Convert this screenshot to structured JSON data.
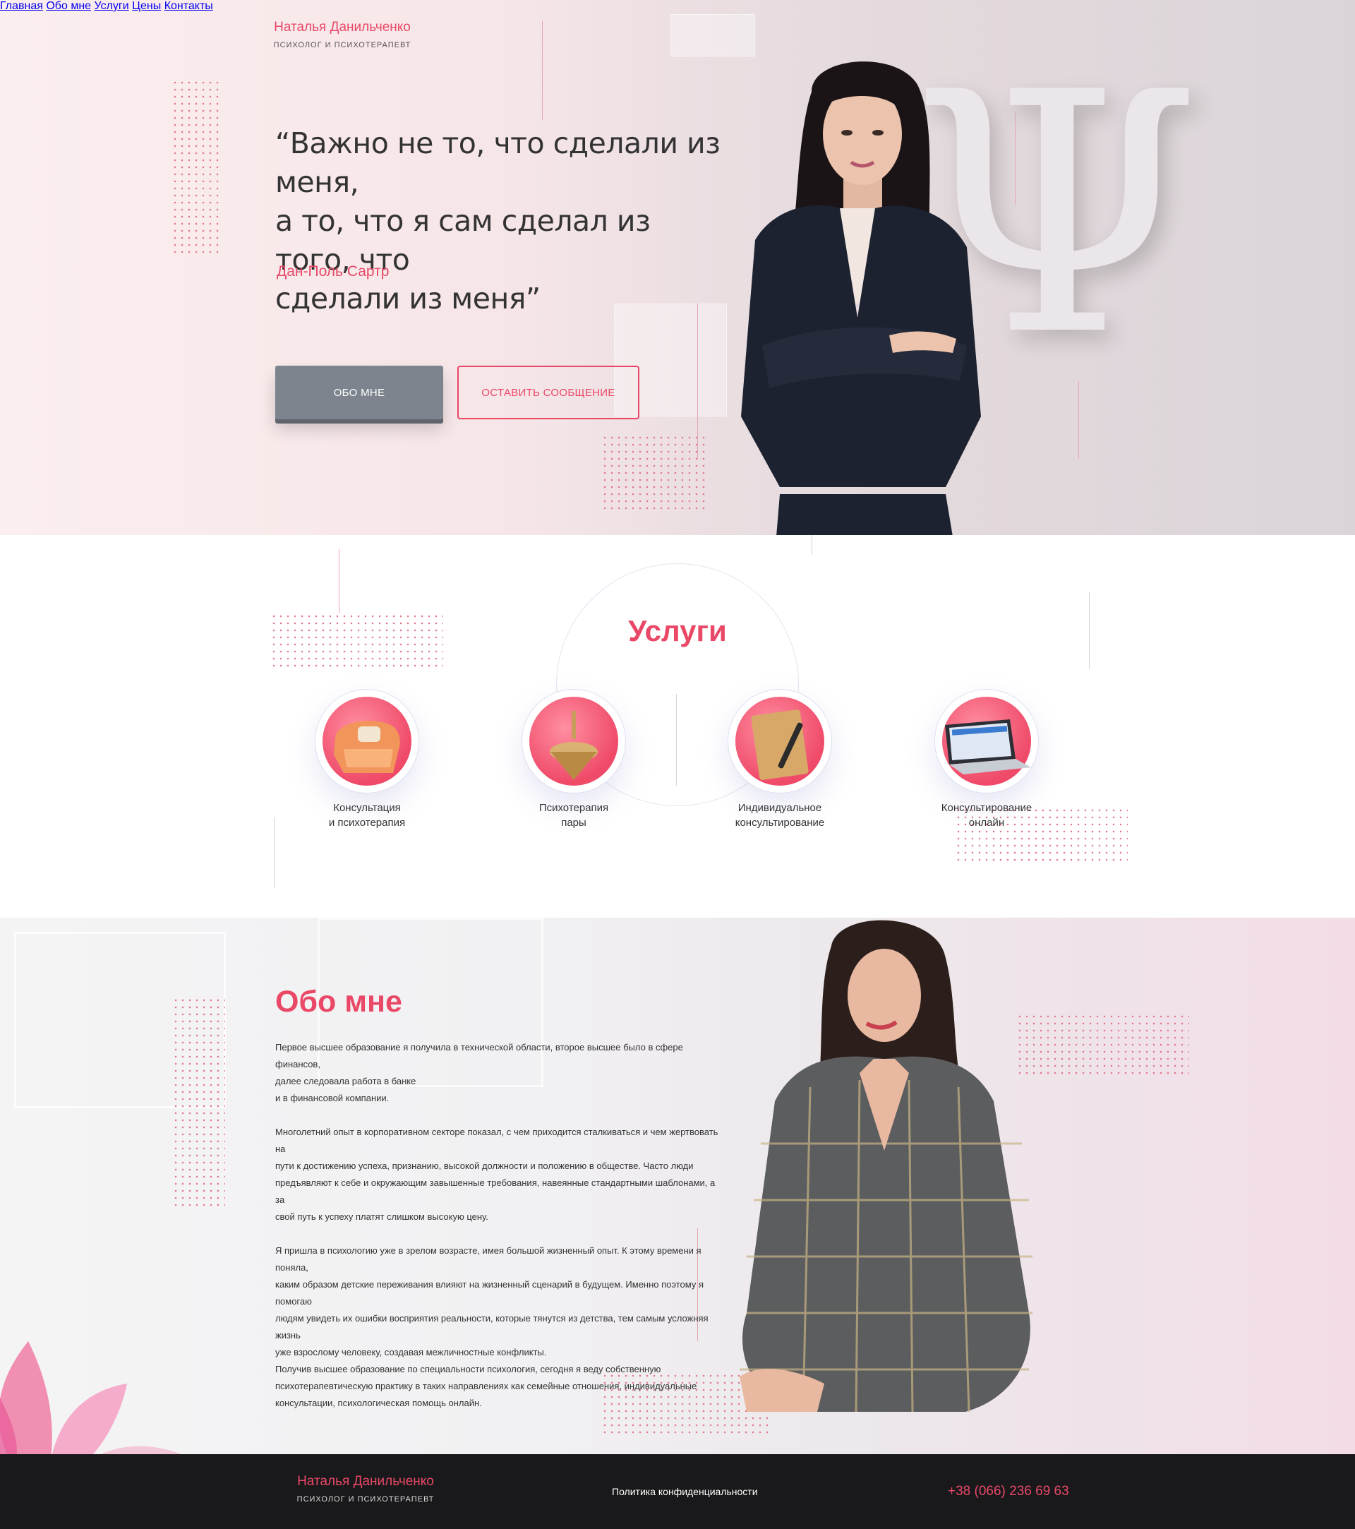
{
  "brand": {
    "name": "Наталья Данильченко",
    "subtitle": "ПСИХОЛОГ И ПСИХОТЕРАПЕВТ"
  },
  "nav": {
    "items": [
      {
        "label": "Главная"
      },
      {
        "label": "Обо мне"
      },
      {
        "label": "Услуги"
      },
      {
        "label": "Цены"
      },
      {
        "label": "Контакты"
      }
    ]
  },
  "hero": {
    "quote_lines": [
      "“Важно не то, что сделали из меня,",
      "а то, что я сам сделал из того, что",
      "сделали из меня”"
    ],
    "author": "Дан-Поль Сартр",
    "primary_button": "ОБО МНЕ",
    "secondary_button": "ОСТАВИТЬ СООБЩЕНИЕ",
    "symbol": "Ψ"
  },
  "services": {
    "title": "Услуги",
    "items": [
      {
        "icon": "armchair-icon",
        "line1": "Консультация",
        "line2": "и психотерапия"
      },
      {
        "icon": "spinning-top-icon",
        "line1": "Психотерапия",
        "line2": "пары"
      },
      {
        "icon": "notebook-pen-icon",
        "line1": "Индивидуальное",
        "line2": "консультирование"
      },
      {
        "icon": "laptop-icon",
        "line1": "Консультирование",
        "line2": "онлайн"
      }
    ]
  },
  "about": {
    "title": "Обо мне",
    "paragraphs": [
      {
        "lines": [
          "Первое высшее образование я получила в технической области, второе высшее было в сфере финансов,",
          "далее следовала работа в банке",
          "и в финансовой компании."
        ]
      },
      {
        "lines": [
          "Многолетний опыт в корпоративном секторе показал, с чем приходится сталкиваться и чем жертвовать на",
          "пути к достижению успеха, признанию, высокой должности и положению в обществе. Часто люди",
          "предъявляют к себе и окружающим завышенные требования, навеянные стандартными шаблонами, а за",
          "свой путь к успеху платят слишком высокую цену."
        ]
      },
      {
        "lines": [
          "Я пришла в психологию уже в зрелом возрасте, имея большой жизненный опыт. К этому времени я поняла,",
          "каким образом детские переживания влияют на жизненный сценарий в будущем. Именно поэтому я помогаю",
          "людям увидеть их ошибки восприятия реальности, которые тянутся из детства, тем самым усложняя жизнь",
          "уже взрослому человеку, создавая межличностные конфликты.",
          "Получив высшее образование по специальности психология, сегодня я веду собственную",
          "психотерапевтическую практику в таких направлениях как семейные отношения, индивидуальные",
          "консультации, психологическая помощь онлайн."
        ]
      }
    ]
  },
  "footer": {
    "brand_name": "Наталья Данильченко",
    "brand_subtitle": "ПСИХОЛОГ И ПСИХОТЕРАПЕВТ",
    "privacy_link": "Политика конфиденциальности",
    "phone": "+38 (066) 236 69 63"
  },
  "colors": {
    "accent": "#e94867",
    "button_grey": "#7d848d",
    "footer_bg": "#19191b"
  }
}
